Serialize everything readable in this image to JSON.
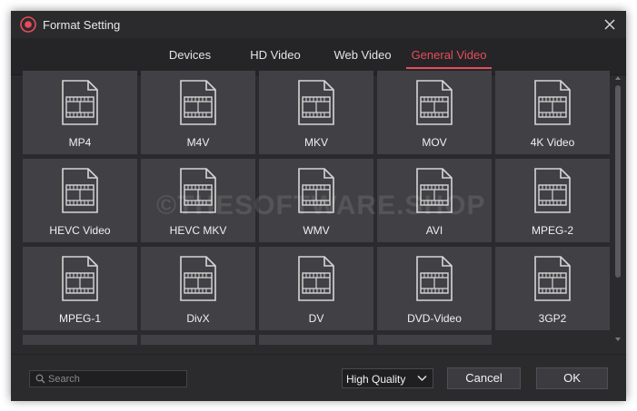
{
  "window": {
    "title": "Format Setting",
    "accent_color": "#e84c5a",
    "app_icon": "record-icon",
    "close_icon": "close-icon"
  },
  "tabs": [
    {
      "label": "Devices",
      "active": false
    },
    {
      "label": "HD Video",
      "active": false
    },
    {
      "label": "Web Video",
      "active": false
    },
    {
      "label": "General Video",
      "active": true
    }
  ],
  "formats": [
    {
      "label": "MP4",
      "icon": "video-file-icon"
    },
    {
      "label": "M4V",
      "icon": "video-file-icon"
    },
    {
      "label": "MKV",
      "icon": "video-file-icon"
    },
    {
      "label": "MOV",
      "icon": "video-file-icon"
    },
    {
      "label": "4K Video",
      "icon": "video-file-icon"
    },
    {
      "label": "HEVC Video",
      "icon": "video-file-icon"
    },
    {
      "label": "HEVC MKV",
      "icon": "video-file-icon"
    },
    {
      "label": "WMV",
      "icon": "video-file-icon"
    },
    {
      "label": "AVI",
      "icon": "video-file-icon"
    },
    {
      "label": "MPEG-2",
      "icon": "video-file-icon"
    },
    {
      "label": "MPEG-1",
      "icon": "video-file-icon"
    },
    {
      "label": "DivX",
      "icon": "video-file-icon"
    },
    {
      "label": "DV",
      "icon": "video-file-icon"
    },
    {
      "label": "DVD-Video",
      "icon": "video-file-icon"
    },
    {
      "label": "3GP2",
      "icon": "video-file-icon"
    }
  ],
  "watermark": "©THESOFTWARE.SHOP",
  "footer": {
    "search_placeholder": "Search",
    "search_icon": "search-icon",
    "quality_selected": "High Quality",
    "cancel_label": "Cancel",
    "ok_label": "OK"
  }
}
